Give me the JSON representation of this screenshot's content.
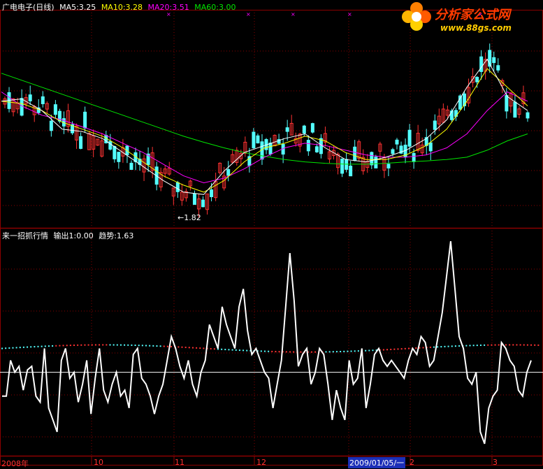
{
  "header": {
    "stock_name": "广电电子(日线)",
    "ma5": "MA5:3.25",
    "ma10": "MA10:3.28",
    "ma20": "MA20:3.51",
    "ma60": "MA60:3.00"
  },
  "logo": {
    "title": "分析家公式网",
    "url": "www.88gs.com"
  },
  "indicator": {
    "name": "来一招抓行情",
    "output": "输出1:0.00",
    "trend": "趋势:1.63"
  },
  "low_marker": "←1.82",
  "x_axis": {
    "labels": [
      "2008年",
      "10",
      "11",
      "12",
      "2",
      "3"
    ],
    "cursor_date": "2009/01/05/一"
  },
  "colors": {
    "up_candle": "#ff3232",
    "down_candle": "#54ffff",
    "ma5": "#ffffff",
    "ma10": "#ffff00",
    "ma20": "#ff00ff",
    "ma60": "#00e600",
    "grid": "#8b0000",
    "indicator_line": "#ffffff"
  },
  "chart_data": [
    {
      "type": "line",
      "title": "广电电子(日线)",
      "series": [
        {
          "name": "MA60",
          "values": [
            4.9,
            4.75,
            4.6,
            4.45,
            4.3,
            4.15,
            4.0,
            3.85,
            3.7,
            3.55,
            3.42,
            3.3,
            3.2,
            3.12,
            3.05,
            3.0,
            2.97,
            2.95,
            2.95,
            2.97,
            3.0,
            3.02,
            3.05,
            3.1,
            3.25,
            3.45,
            3.6
          ]
        },
        {
          "name": "MA20",
          "values": [
            4.5,
            4.2,
            4.0,
            3.9,
            3.75,
            3.6,
            3.4,
            3.2,
            2.95,
            2.7,
            2.55,
            2.65,
            2.85,
            3.1,
            3.3,
            3.4,
            3.35,
            3.25,
            3.15,
            3.1,
            3.1,
            3.15,
            3.3,
            3.6,
            4.1,
            4.5,
            4.3
          ]
        },
        {
          "name": "MA10",
          "values": [
            4.3,
            4.25,
            4.1,
            3.85,
            3.7,
            3.55,
            3.3,
            3.0,
            2.7,
            2.5,
            2.35,
            2.6,
            3.0,
            3.3,
            3.4,
            3.55,
            3.45,
            3.2,
            3.05,
            3.05,
            3.15,
            3.35,
            3.7,
            4.3,
            5.0,
            4.6,
            4.2
          ]
        },
        {
          "name": "MA5",
          "values": [
            4.3,
            4.35,
            4.1,
            3.7,
            3.65,
            3.5,
            3.2,
            2.9,
            2.6,
            2.35,
            2.3,
            2.8,
            3.2,
            3.35,
            3.5,
            3.6,
            3.3,
            3.05,
            3.0,
            3.1,
            3.25,
            3.5,
            3.9,
            4.6,
            5.2,
            4.4,
            4.1
          ]
        }
      ],
      "annotations": [
        "←1.82"
      ]
    },
    {
      "type": "line",
      "title": "来一招抓行情",
      "series": [
        {
          "name": "输出1",
          "values": [
            -20,
            -20,
            10,
            0,
            5,
            -15,
            2,
            5,
            -20,
            -25,
            20,
            -30,
            -40,
            -50,
            10,
            20,
            -5,
            0,
            -25,
            -10,
            10,
            -35,
            -5,
            20,
            -15,
            -25,
            -10,
            0,
            -20,
            -15,
            -30,
            15,
            20,
            -5,
            -10,
            -20,
            -35,
            -20,
            -10,
            10,
            30,
            20,
            5,
            -5,
            10,
            -10,
            -20,
            0,
            10,
            40,
            30,
            20,
            55,
            40,
            30,
            20,
            55,
            70,
            35,
            15,
            20,
            10,
            0,
            -5,
            -30,
            -10,
            10,
            55,
            100,
            60,
            5,
            15,
            20,
            -10,
            0,
            20,
            15,
            -10,
            -40,
            -15,
            -30,
            -40,
            10,
            -10,
            -5,
            20,
            -30,
            -10,
            15,
            20,
            10,
            5,
            10,
            5,
            0,
            -5,
            10,
            20,
            15,
            30,
            25,
            5,
            10,
            30,
            50,
            80,
            110,
            70,
            30,
            20,
            -5,
            -10,
            0,
            -50,
            -60,
            -30,
            -20,
            -15,
            25,
            20,
            10,
            5,
            -15,
            -20,
            0,
            10
          ]
        }
      ]
    }
  ]
}
